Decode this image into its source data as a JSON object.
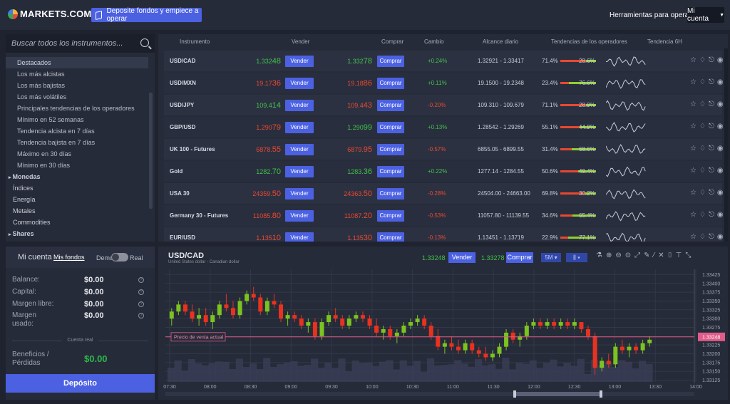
{
  "brand": {
    "name": "MARKETS.COM"
  },
  "header": {
    "deposit_cta": "Deposite fondos y empiece a operar",
    "tools_menu": "Herramientas para operar",
    "account_menu": "Mi cuenta"
  },
  "sidebar": {
    "search_placeholder": "Buscar todos los instrumentos...",
    "items": [
      {
        "label": "Destacados",
        "level": "sub",
        "active": true
      },
      {
        "label": "Los más alcistas",
        "level": "sub"
      },
      {
        "label": "Los más bajistas",
        "level": "sub"
      },
      {
        "label": "Los más volátiles",
        "level": "sub"
      },
      {
        "label": "Principales tendencias de los operadores",
        "level": "sub"
      },
      {
        "label": "Mínimo en 52 semanas",
        "level": "sub"
      },
      {
        "label": "Tendencia alcista en 7 días",
        "level": "sub"
      },
      {
        "label": "Tendencia bajista en 7 días",
        "level": "sub"
      },
      {
        "label": "Máximo en 30 días",
        "level": "sub"
      },
      {
        "label": "Mínimo en 30 días",
        "level": "sub"
      },
      {
        "label": "Monedas",
        "level": "topbold"
      },
      {
        "label": "Índices",
        "level": "top"
      },
      {
        "label": "Energía",
        "level": "top"
      },
      {
        "label": "Metales",
        "level": "top"
      },
      {
        "label": "Commodities",
        "level": "top"
      },
      {
        "label": "Shares",
        "level": "topbold"
      }
    ]
  },
  "account": {
    "title": "Mi cuenta",
    "funds_link": "Mis fondos",
    "demo_label": "Demo",
    "real_label": "Real",
    "rows": [
      {
        "label": "Balance:",
        "value": "$0.00"
      },
      {
        "label": "Capital:",
        "value": "$0.00"
      },
      {
        "label": "Margen libre:",
        "value": "$0.00"
      },
      {
        "label": "Margen usado:",
        "value": "$0.00"
      }
    ],
    "section_label": "Cuenta real",
    "profit_label": "Beneficios / Pérdidas",
    "profit_value": "$0.00",
    "deposit_button": "Depósito"
  },
  "table": {
    "headers": {
      "instrument": "Instrumento",
      "sell": "Vender",
      "buy": "Comprar",
      "change": "Cambio",
      "range": "Alcance diario",
      "trends": "Tendencias de los operadores",
      "trend6h": "Tendencia 6H"
    },
    "sell_label": "Vender",
    "buy_label": "Comprar",
    "rows": [
      {
        "symbol": "USD/CAD",
        "sell_main": "1.332",
        "sell_big": "48",
        "sell_dir": "up",
        "buy_main": "1.332",
        "buy_big": "78",
        "buy_dir": "up",
        "change": "+0.24%",
        "change_dir": "up",
        "range": "1.32921 - 1.33417",
        "sell_pct": "71.4%",
        "buy_pct": "28.6%",
        "sell_share": 0.714
      },
      {
        "symbol": "USD/MXN",
        "sell_main": "19.17",
        "sell_big": "36",
        "sell_dir": "dn",
        "buy_main": "19.18",
        "buy_big": "86",
        "buy_dir": "dn",
        "change": "+0.11%",
        "change_dir": "up",
        "range": "19.1500 - 19.2348",
        "sell_pct": "23.4%",
        "buy_pct": "76.6%",
        "sell_share": 0.234
      },
      {
        "symbol": "USD/JPY",
        "sell_main": "109.4",
        "sell_big": "14",
        "sell_dir": "up",
        "buy_main": "109.4",
        "buy_big": "43",
        "buy_dir": "dn",
        "change": "-0.20%",
        "change_dir": "dn",
        "range": "109.310 - 109.679",
        "sell_pct": "71.1%",
        "buy_pct": "28.9%",
        "sell_share": 0.711
      },
      {
        "symbol": "GBP/USD",
        "sell_main": "1.290",
        "sell_big": "79",
        "sell_dir": "dn",
        "buy_main": "1.290",
        "buy_big": "99",
        "buy_dir": "up",
        "change": "+0.13%",
        "change_dir": "up",
        "range": "1.28542 - 1.29269",
        "sell_pct": "55.1%",
        "buy_pct": "44.9%",
        "sell_share": 0.551
      },
      {
        "symbol": "UK 100 - Futures",
        "sell_main": "6878.",
        "sell_big": "55",
        "sell_dir": "dn",
        "buy_main": "6879.",
        "buy_big": "95",
        "buy_dir": "dn",
        "change": "-0.57%",
        "change_dir": "dn",
        "range": "6855.05 - 6899.55",
        "sell_pct": "31.4%",
        "buy_pct": "68.6%",
        "sell_share": 0.314
      },
      {
        "symbol": "Gold",
        "sell_main": "1282.",
        "sell_big": "70",
        "sell_dir": "up",
        "buy_main": "1283.",
        "buy_big": "36",
        "buy_dir": "up",
        "change": "+0.22%",
        "change_dir": "up",
        "range": "1277.14 - 1284.55",
        "sell_pct": "50.6%",
        "buy_pct": "49.4%",
        "sell_share": 0.506
      },
      {
        "symbol": "USA 30",
        "sell_main": "24359.",
        "sell_big": "50",
        "sell_dir": "dn",
        "buy_main": "24363.",
        "buy_big": "50",
        "buy_dir": "dn",
        "change": "-0.28%",
        "change_dir": "dn",
        "range": "24504.00 - 24663.00",
        "sell_pct": "69.8%",
        "buy_pct": "30.2%",
        "sell_share": 0.698
      },
      {
        "symbol": "Germany 30 - Futures",
        "sell_main": "11085.",
        "sell_big": "80",
        "sell_dir": "dn",
        "buy_main": "11087.",
        "buy_big": "20",
        "buy_dir": "dn",
        "change": "-0.53%",
        "change_dir": "dn",
        "range": "11057.80 - 11139.55",
        "sell_pct": "34.6%",
        "buy_pct": "65.4%",
        "sell_share": 0.346
      },
      {
        "symbol": "EUR/USD",
        "sell_main": "1.135",
        "sell_big": "10",
        "sell_dir": "dn",
        "buy_main": "1.135",
        "buy_big": "30",
        "buy_dir": "dn",
        "change": "-0.13%",
        "change_dir": "dn",
        "range": "1.13451 - 1.13719",
        "sell_pct": "22.9%",
        "buy_pct": "77.1%",
        "sell_share": 0.229
      }
    ]
  },
  "chart_header": {
    "symbol": "USD/CAD",
    "subtitle": "United States dollar - Canadian dollar",
    "sell_price": "1.33248",
    "sell_label": "Vender",
    "buy_price": "1.33278",
    "buy_label": "Comprar",
    "timeframe": "5M",
    "price_tag": "Precio de venta actual"
  },
  "colors": {
    "accent": "#4b61e2",
    "up": "#3ec24a",
    "down": "#e8492f",
    "current_line": "#e05c8a"
  },
  "icons": [
    "star-icon",
    "bell-icon",
    "share-icon",
    "play-circle-icon"
  ],
  "chart_data": {
    "type": "candlestick",
    "x_ticks": [
      "07:30",
      "08:00",
      "08:30",
      "09:00",
      "09:30",
      "10:00",
      "10:30",
      "11:00",
      "11:30",
      "12:00",
      "12:30",
      "13:00",
      "13:30",
      "14:00"
    ],
    "y_ticks": [
      "1.33425",
      "1.33400",
      "1.33375",
      "1.33350",
      "1.33325",
      "1.33300",
      "1.33275",
      "1.33248",
      "1.33225",
      "1.33200",
      "1.33175",
      "1.33150",
      "1.33125"
    ],
    "ylim": [
      1.3312,
      1.3344
    ],
    "current_price": 1.33248,
    "candles": [
      [
        1.333,
        1.3333,
        1.3328,
        1.3332
      ],
      [
        1.3332,
        1.3335,
        1.3331,
        1.3334
      ],
      [
        1.3334,
        1.3335,
        1.3331,
        1.3332
      ],
      [
        1.3332,
        1.3334,
        1.3329,
        1.333
      ],
      [
        1.333,
        1.3333,
        1.3328,
        1.3331
      ],
      [
        1.3331,
        1.3333,
        1.3328,
        1.3329
      ],
      [
        1.3329,
        1.3332,
        1.3327,
        1.3331
      ],
      [
        1.3331,
        1.3335,
        1.333,
        1.3334
      ],
      [
        1.3334,
        1.3337,
        1.3332,
        1.3333
      ],
      [
        1.3333,
        1.3335,
        1.333,
        1.3331
      ],
      [
        1.3331,
        1.3336,
        1.333,
        1.3335
      ],
      [
        1.3335,
        1.3338,
        1.3334,
        1.3337
      ],
      [
        1.3337,
        1.3339,
        1.3335,
        1.3336
      ],
      [
        1.3336,
        1.3337,
        1.3331,
        1.3332
      ],
      [
        1.3332,
        1.3336,
        1.3331,
        1.3335
      ],
      [
        1.3335,
        1.3337,
        1.3333,
        1.3334
      ],
      [
        1.3334,
        1.3335,
        1.3329,
        1.333
      ],
      [
        1.333,
        1.3332,
        1.3328,
        1.3331
      ],
      [
        1.3331,
        1.3332,
        1.3329,
        1.333
      ],
      [
        1.333,
        1.3331,
        1.3327,
        1.3328
      ],
      [
        1.3328,
        1.333,
        1.3326,
        1.3329
      ],
      [
        1.3329,
        1.333,
        1.3324,
        1.3325
      ],
      [
        1.3325,
        1.333,
        1.3324,
        1.3329
      ],
      [
        1.3329,
        1.3332,
        1.3328,
        1.3331
      ],
      [
        1.3331,
        1.3333,
        1.3329,
        1.333
      ],
      [
        1.333,
        1.3331,
        1.3327,
        1.3328
      ],
      [
        1.3328,
        1.3331,
        1.3327,
        1.333
      ],
      [
        1.333,
        1.3332,
        1.3329,
        1.3331
      ],
      [
        1.3331,
        1.3332,
        1.3329,
        1.333
      ],
      [
        1.333,
        1.3331,
        1.3327,
        1.3328
      ],
      [
        1.3328,
        1.333,
        1.3325,
        1.3326
      ],
      [
        1.3326,
        1.3328,
        1.3324,
        1.3327
      ],
      [
        1.3327,
        1.3328,
        1.3324,
        1.3325
      ],
      [
        1.3325,
        1.3327,
        1.3323,
        1.3326
      ],
      [
        1.3326,
        1.3329,
        1.3325,
        1.3328
      ],
      [
        1.3328,
        1.333,
        1.3327,
        1.3329
      ],
      [
        1.3329,
        1.3331,
        1.3328,
        1.333
      ],
      [
        1.333,
        1.3331,
        1.3327,
        1.3328
      ],
      [
        1.3328,
        1.3329,
        1.3324,
        1.3325
      ],
      [
        1.3325,
        1.3327,
        1.3321,
        1.3322
      ],
      [
        1.3322,
        1.3324,
        1.332,
        1.3323
      ],
      [
        1.3323,
        1.3325,
        1.3321,
        1.3322
      ],
      [
        1.3322,
        1.3324,
        1.332,
        1.3321
      ],
      [
        1.3321,
        1.3324,
        1.332,
        1.3323
      ],
      [
        1.3323,
        1.3324,
        1.332,
        1.3321
      ],
      [
        1.3321,
        1.3322,
        1.3319,
        1.332
      ],
      [
        1.332,
        1.3322,
        1.3318,
        1.3319
      ],
      [
        1.3319,
        1.3321,
        1.3318,
        1.332
      ],
      [
        1.332,
        1.3323,
        1.3319,
        1.3322
      ],
      [
        1.3322,
        1.3327,
        1.3321,
        1.3326
      ],
      [
        1.3326,
        1.3327,
        1.3323,
        1.3324
      ],
      [
        1.3324,
        1.3326,
        1.3322,
        1.3325
      ],
      [
        1.3325,
        1.3329,
        1.3324,
        1.3328
      ],
      [
        1.3328,
        1.333,
        1.3327,
        1.3329
      ],
      [
        1.3329,
        1.333,
        1.3327,
        1.3328
      ],
      [
        1.3328,
        1.333,
        1.3327,
        1.3329
      ],
      [
        1.3329,
        1.333,
        1.3327,
        1.3328
      ],
      [
        1.3328,
        1.333,
        1.3327,
        1.3329
      ],
      [
        1.3329,
        1.333,
        1.3327,
        1.3328
      ],
      [
        1.3328,
        1.333,
        1.3327,
        1.3329
      ],
      [
        1.3329,
        1.3329,
        1.3326,
        1.3327
      ],
      [
        1.3327,
        1.3328,
        1.3324,
        1.3325
      ],
      [
        1.3325,
        1.3326,
        1.3314,
        1.3316
      ],
      [
        1.3316,
        1.3319,
        1.3315,
        1.3318
      ],
      [
        1.3318,
        1.332,
        1.3316,
        1.3317
      ],
      [
        1.3317,
        1.3323,
        1.3316,
        1.3322
      ],
      [
        1.3322,
        1.3324,
        1.332,
        1.3321
      ],
      [
        1.3321,
        1.3323,
        1.3319,
        1.3322
      ],
      [
        1.3322,
        1.3323,
        1.332,
        1.3321
      ],
      [
        1.3321,
        1.3324,
        1.332,
        1.3323
      ],
      [
        1.3323,
        1.3325,
        1.3322,
        1.3324
      ]
    ]
  }
}
